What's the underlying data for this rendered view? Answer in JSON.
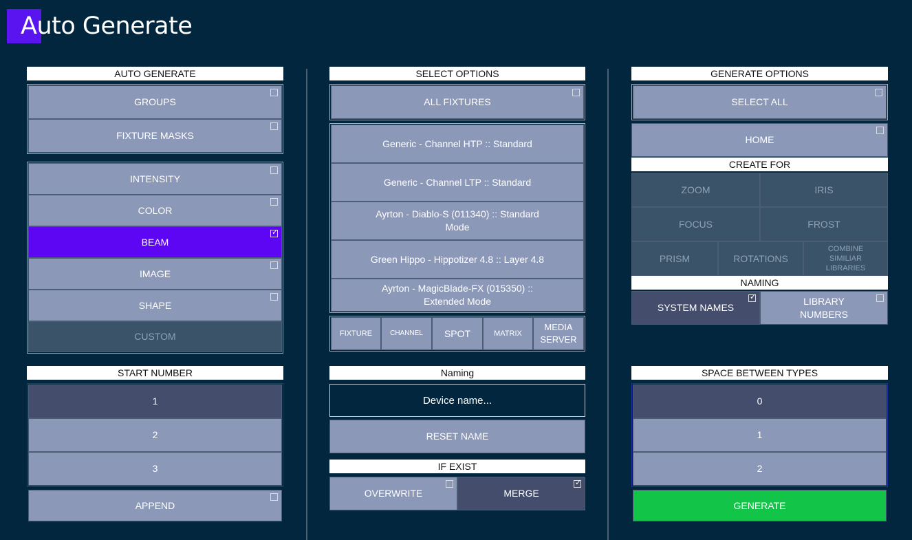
{
  "app": {
    "title": "Auto Generate"
  },
  "left": {
    "header": "AUTO GENERATE",
    "type_buttons": [
      {
        "label": "GROUPS",
        "checked": false
      },
      {
        "label": "FIXTURE MASKS",
        "checked": false
      }
    ],
    "feature_buttons": [
      {
        "label": "INTENSITY",
        "checked": false
      },
      {
        "label": "COLOR",
        "checked": false
      },
      {
        "label": "BEAM",
        "checked": true
      },
      {
        "label": "IMAGE",
        "checked": false
      },
      {
        "label": "SHAPE",
        "checked": false
      },
      {
        "label": "CUSTOM"
      }
    ],
    "start_number_header": "START NUMBER",
    "start_numbers": [
      "1",
      "2",
      "3"
    ],
    "append_label": "APPEND"
  },
  "middle": {
    "header": "SELECT OPTIONS",
    "all_fixtures_label": "ALL FIXTURES",
    "fixtures": [
      "Generic - Channel HTP :: Standard",
      "Generic - Channel LTP :: Standard",
      "Ayrton - Diablo-S (011340) :: Standard Mode",
      "Green Hippo - Hippotizer 4.8 :: Layer 4.8",
      "Ayrton - MagicBlade-FX (015350) :: Extended Mode"
    ],
    "filter_tabs": [
      "FIXTURE",
      "CHANNEL",
      "SPOT",
      "MATRIX",
      "MEDIA SERVER"
    ],
    "naming_header": "Naming",
    "device_name_placeholder": "Device name...",
    "reset_name_label": "RESET NAME",
    "if_exist_header": "IF EXIST",
    "overwrite_label": "OVERWRITE",
    "merge_label": "MERGE"
  },
  "right": {
    "header": "GENERATE OPTIONS",
    "select_all_label": "SELECT ALL",
    "home_label": "HOME",
    "create_for_header": "CREATE FOR",
    "create_for": [
      "ZOOM",
      "IRIS",
      "FOCUS",
      "FROST",
      "PRISM",
      "ROTATIONS",
      "COMBINE SIMILIAR LIBRARIES"
    ],
    "naming_header": "NAMING",
    "system_names_label": "SYSTEM NAMES",
    "library_numbers_label": "LIBRARY NUMBERS",
    "space_header": "SPACE BETWEEN TYPES",
    "space_values": [
      "0",
      "1",
      "2"
    ],
    "generate_label": "GENERATE"
  },
  "colors": {
    "background": "#03263f",
    "button": "#8c98b8",
    "selected": "#5d06f4",
    "generate": "#12c548"
  }
}
